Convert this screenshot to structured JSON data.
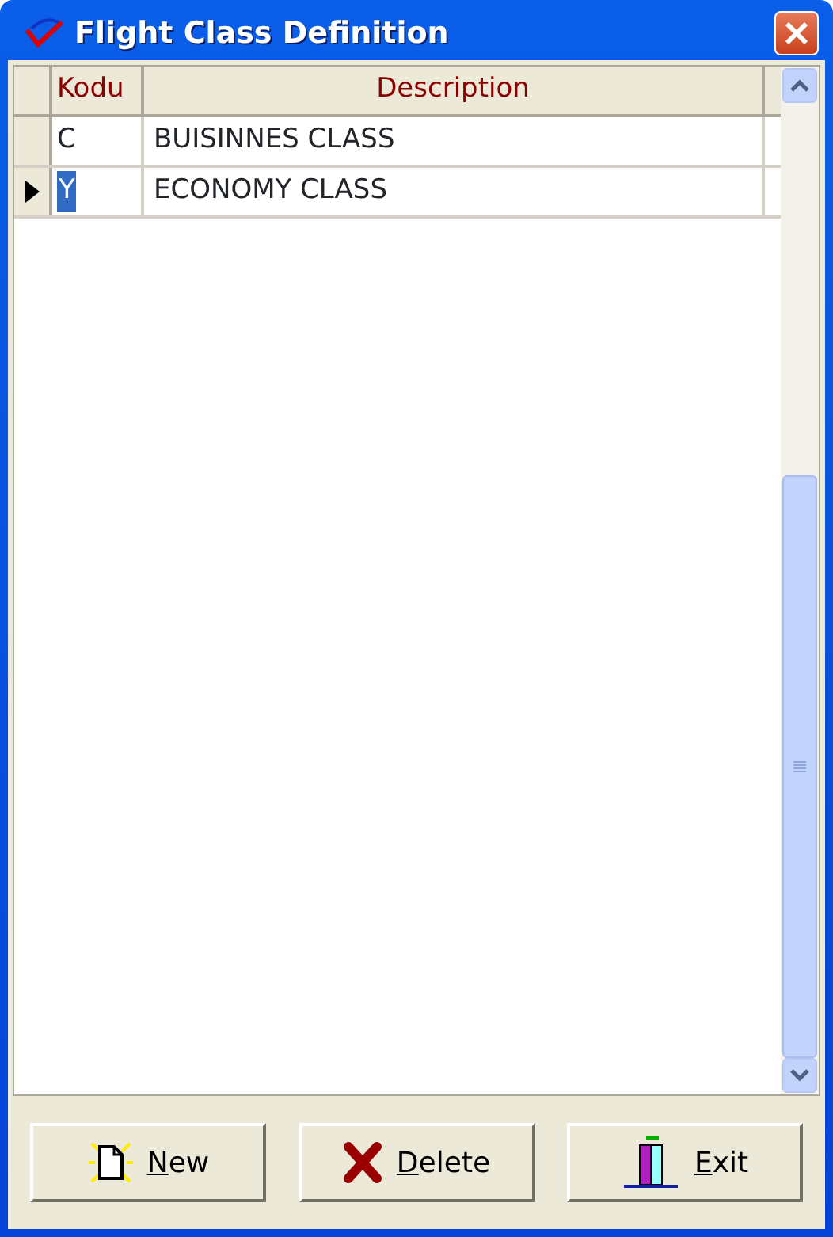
{
  "window": {
    "title": "Flight Class Definition"
  },
  "table": {
    "columns": [
      "Kodu",
      "Description"
    ],
    "rows": [
      {
        "cells": [
          "C",
          "BUISINNES CLASS"
        ],
        "selected": false
      },
      {
        "cells": [
          "Y",
          "ECONOMY CLASS"
        ],
        "selected": true
      }
    ]
  },
  "buttons": [
    {
      "kind": "new",
      "accel": "N",
      "rest": "ew"
    },
    {
      "kind": "delete",
      "accel": "D",
      "rest": "elete"
    },
    {
      "kind": "exit",
      "accel": "E",
      "rest": "xit"
    }
  ]
}
